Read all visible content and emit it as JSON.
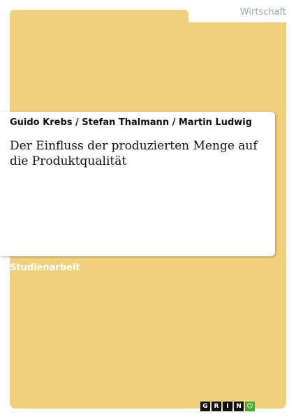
{
  "category": "Wirtschaft",
  "authors": "Guido Krebs / Stefan Thalmann / Martin Ludwig",
  "title": "Der Einfluss der produzierten Menge auf die Produktqualität",
  "type": "Studienarbeit",
  "logo": [
    "G",
    "R",
    "I",
    "N",
    "☺"
  ]
}
